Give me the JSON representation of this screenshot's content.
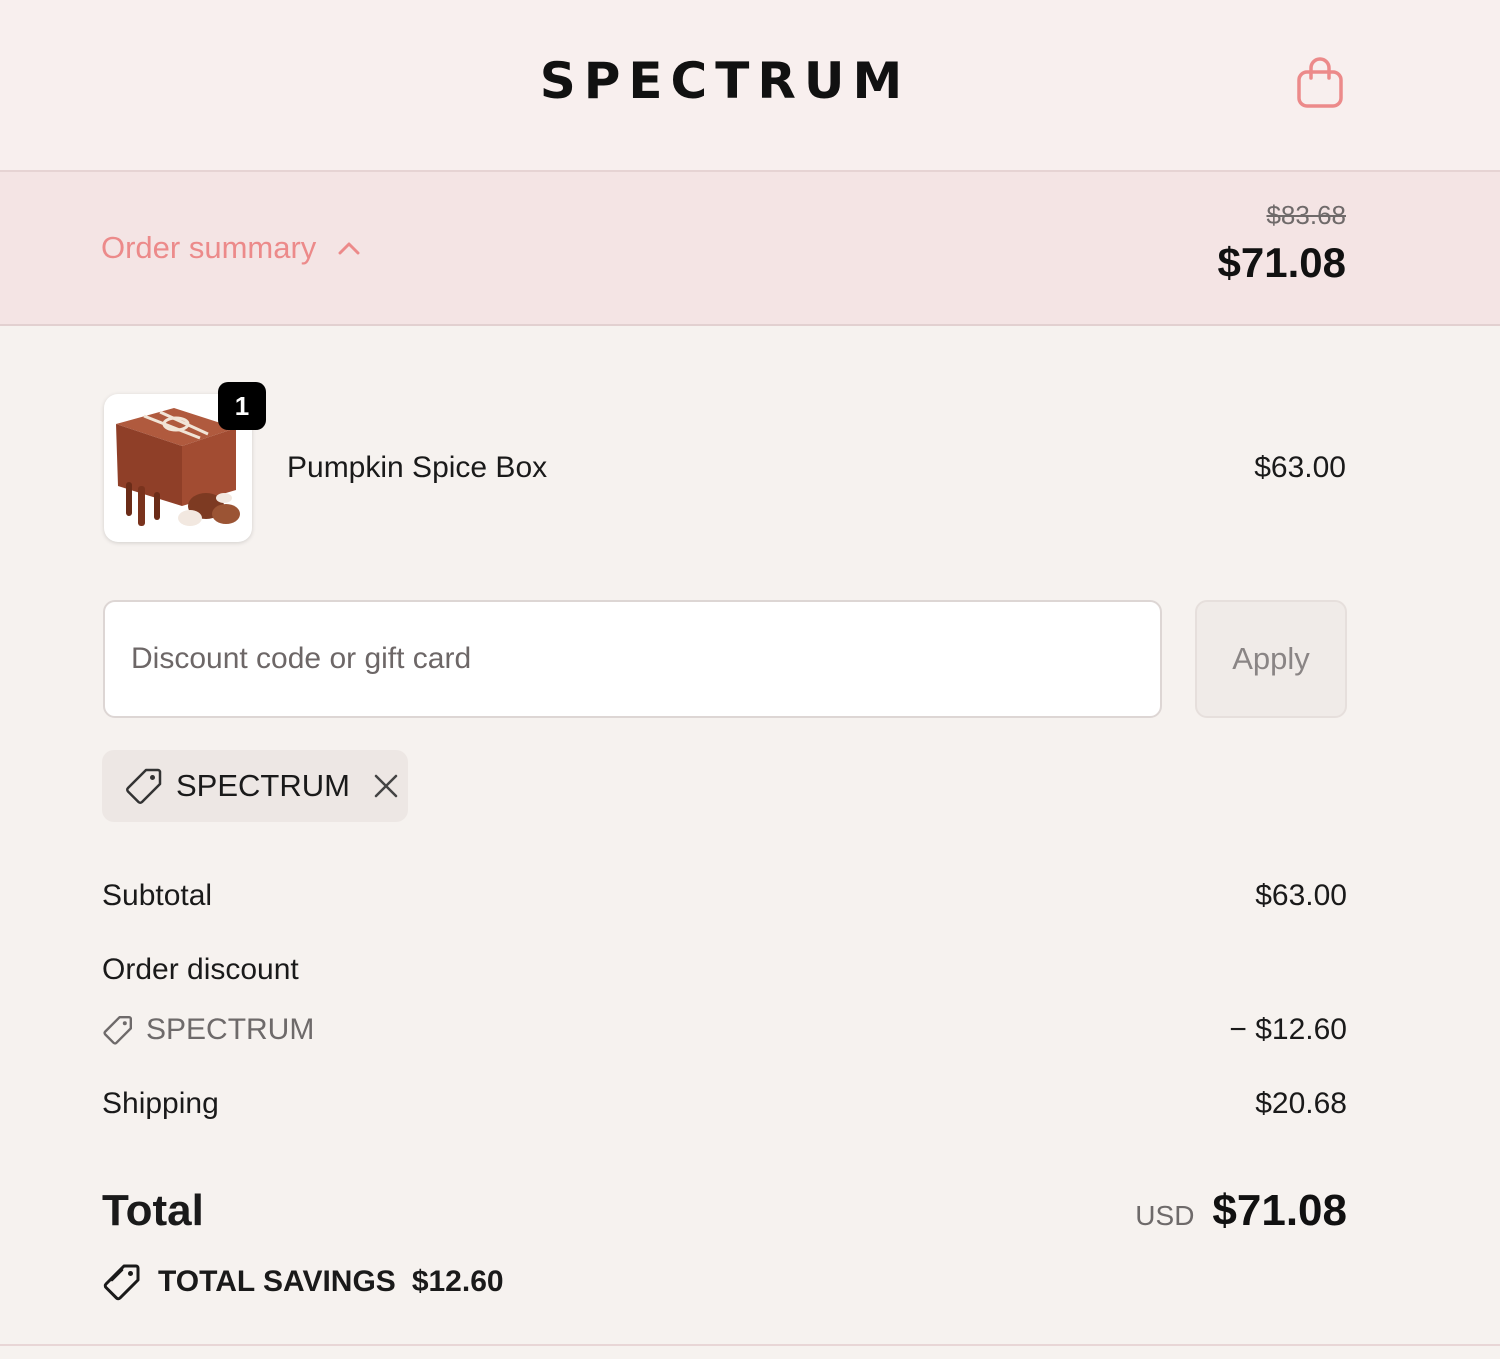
{
  "header": {
    "logo_text": "SPECTRUM",
    "cart_icon": "shopping-bag-icon"
  },
  "summary_bar": {
    "toggle_label": "Order summary",
    "toggle_icon": "chevron-up-icon",
    "original_price": "$83.68",
    "total_price": "$71.08"
  },
  "cart": {
    "items": [
      {
        "name": "Pumpkin Spice Box",
        "quantity": "1",
        "price": "$63.00",
        "image": "chocolate-box-image"
      }
    ]
  },
  "discount": {
    "placeholder": "Discount code or gift card",
    "value": "",
    "apply_label": "Apply",
    "applied_code": "SPECTRUM"
  },
  "totals": {
    "subtotal_label": "Subtotal",
    "subtotal_value": "$63.00",
    "order_discount_label": "Order discount",
    "discount_code": "SPECTRUM",
    "discount_value": "− $12.60",
    "shipping_label": "Shipping",
    "shipping_value": "$20.68",
    "total_label": "Total",
    "currency": "USD",
    "total_value": "$71.08",
    "savings_label": "TOTAL SAVINGS",
    "savings_value": "$12.60"
  },
  "colors": {
    "accent_pink": "#ec8a8a",
    "header_bg": "#f8efee",
    "summary_bg": "#f4e4e4",
    "page_bg": "#f6f2ef"
  }
}
